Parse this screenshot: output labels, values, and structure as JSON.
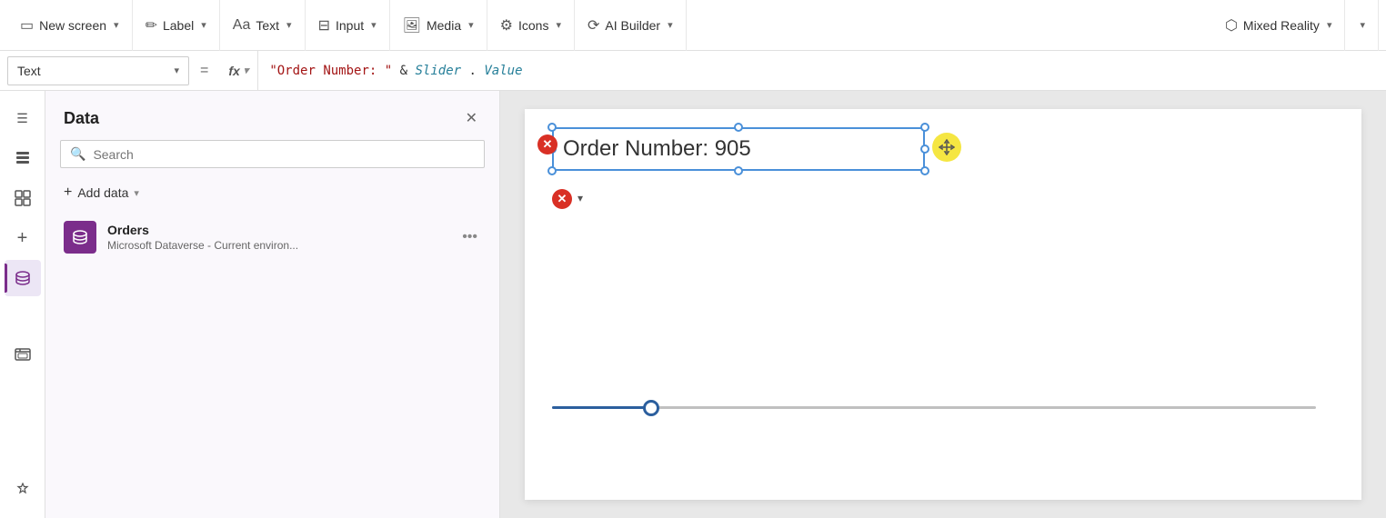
{
  "toolbar": {
    "new_screen_label": "New screen",
    "label_label": "Label",
    "text_label": "Text",
    "input_label": "Input",
    "media_label": "Media",
    "icons_label": "Icons",
    "ai_builder_label": "AI Builder",
    "mixed_reality_label": "Mixed Reality"
  },
  "formula_bar": {
    "property_label": "Text",
    "equals": "=",
    "fx_label": "fx",
    "expression": "\"Order Number: \" & Slider.Value"
  },
  "sidebar": {
    "hamburger": "☰",
    "icons": [
      {
        "name": "hamburger-menu",
        "symbol": "☰",
        "active": false
      },
      {
        "name": "layers",
        "symbol": "⊞",
        "active": false
      },
      {
        "name": "shapes",
        "symbol": "◈",
        "active": false
      },
      {
        "name": "add",
        "symbol": "+",
        "active": false
      },
      {
        "name": "database",
        "symbol": "⬤",
        "active": true
      },
      {
        "name": "chart",
        "symbol": "⊡",
        "active": false
      },
      {
        "name": "settings",
        "symbol": "⚙",
        "active": false
      }
    ]
  },
  "data_panel": {
    "title": "Data",
    "search_placeholder": "Search",
    "add_data_label": "Add data",
    "items": [
      {
        "name": "Orders",
        "description": "Microsoft Dataverse - Current environ..."
      }
    ]
  },
  "canvas": {
    "element_text": "Order Number: 905",
    "slider_value": 905,
    "formula_display": "\"Order Number: \" & Slider.Value"
  }
}
